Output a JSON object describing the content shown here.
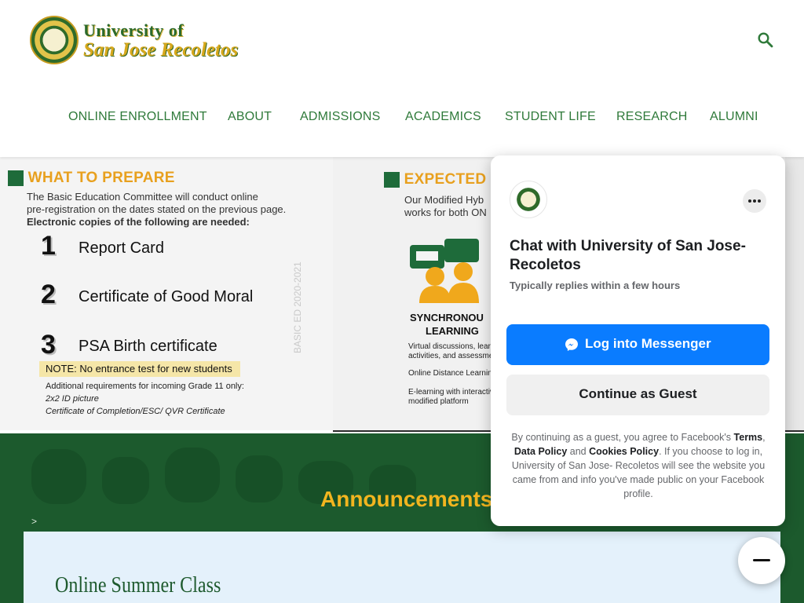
{
  "header": {
    "logo_line1": "University of",
    "logo_line2": "San Jose Recoletos",
    "nav": [
      "ONLINE ENROLLMENT",
      "ABOUT",
      "ADMISSIONS",
      "ACADEMICS",
      "STUDENT LIFE",
      "RESEARCH",
      "ALUMNI"
    ]
  },
  "slider": {
    "left": {
      "heading": "WHAT TO PREPARE",
      "intro1": "The Basic Education Committee will conduct online",
      "intro2": "pre-registration on the dates stated on the previous page.",
      "intro3": "Electronic copies of the following are needed:",
      "items": [
        {
          "num": "1",
          "label": "Report Card"
        },
        {
          "num": "2",
          "label": "Certificate of Good Moral"
        },
        {
          "num": "3",
          "label": "PSA Birth certificate"
        }
      ],
      "note": "NOTE: No entrance test for new students",
      "extra1": "Additional requirements for incoming Grade 11 only:",
      "extra2": "2x2 ID picture",
      "extra3": "Certificate of Completion/ESC/ QVR Certificate",
      "vertical": "BASIC ED 2020-2021"
    },
    "right": {
      "heading": "EXPECTED",
      "intro1": "Our Modified Hyb",
      "intro2": "works for both ON",
      "sync1": "SYNCHRONOU",
      "sync2": "LEARNING",
      "t1": "Virtual discussions, learn",
      "t2": "activities, and assessmen",
      "t3": "Online Distance Learning",
      "t4": "E-learning with interactiv",
      "t5": "modified platform"
    }
  },
  "announcements": {
    "title": "Announcements",
    "crumb": ">",
    "card_title": "Online Summer Class"
  },
  "chat": {
    "title": "Chat with University of San Jose-Recoletos",
    "subtitle": "Typically replies within a few hours",
    "login_label": "Log into Messenger",
    "guest_label": "Continue as Guest",
    "legal_pre": "By continuing as a guest, you agree to Facebook's",
    "terms": "Terms",
    "comma": ",",
    "data_policy": "Data Policy",
    "and": "and",
    "cookies": "Cookies Policy",
    "legal_post": ". If you choose to log in, University of San Jose- Recoletos will see the website you came from and info you've made public on your Facebook profile."
  },
  "colors": {
    "brand_green": "#1c5a2d",
    "accent_gold": "#f2b51f",
    "messenger_blue": "#0a7cff"
  }
}
